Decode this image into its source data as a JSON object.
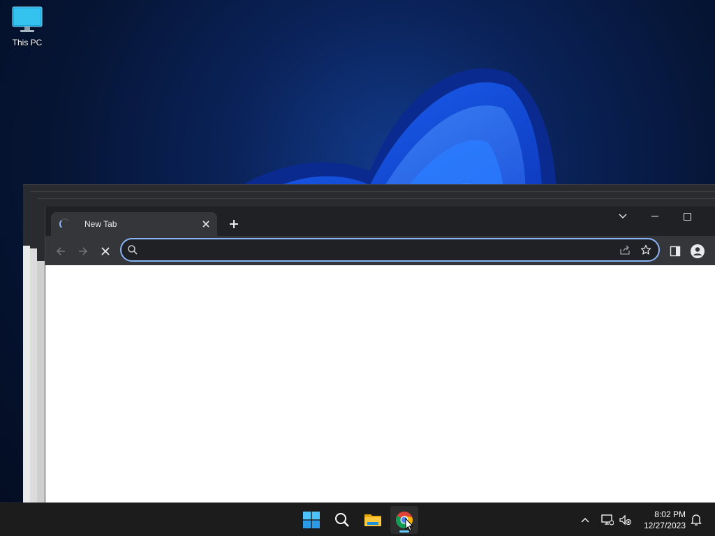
{
  "desktop": {
    "icons": [
      {
        "label": "This PC",
        "icon": "monitor-icon"
      }
    ]
  },
  "browser": {
    "tabs": [
      {
        "title": "New Tab",
        "loading": true
      }
    ],
    "omnibox": {
      "value": "",
      "placeholder": ""
    },
    "toolbar_icons": [
      "back-icon",
      "forward-icon",
      "stop-icon",
      "search-icon",
      "share-icon",
      "bookmark-star-icon",
      "side-panel-icon",
      "profile-icon"
    ],
    "window_controls": [
      "tab-search-icon",
      "minimize-icon",
      "maximize-icon"
    ]
  },
  "taskbar": {
    "apps": [
      "windows-start-icon",
      "search-icon",
      "file-explorer-icon",
      "chrome-icon"
    ],
    "active_app": "chrome-icon",
    "tray_icons": [
      "chevron-up-icon",
      "network-icon",
      "volume-muted-icon",
      "notification-bell-icon"
    ],
    "clock": {
      "time": "8:02 PM",
      "date": "12/27/2023"
    }
  },
  "colors": {
    "accent": "#8ab4f8",
    "taskbar_indicator": "#60cdff",
    "browser_frame": "#202124",
    "toolbar": "#35363a"
  }
}
